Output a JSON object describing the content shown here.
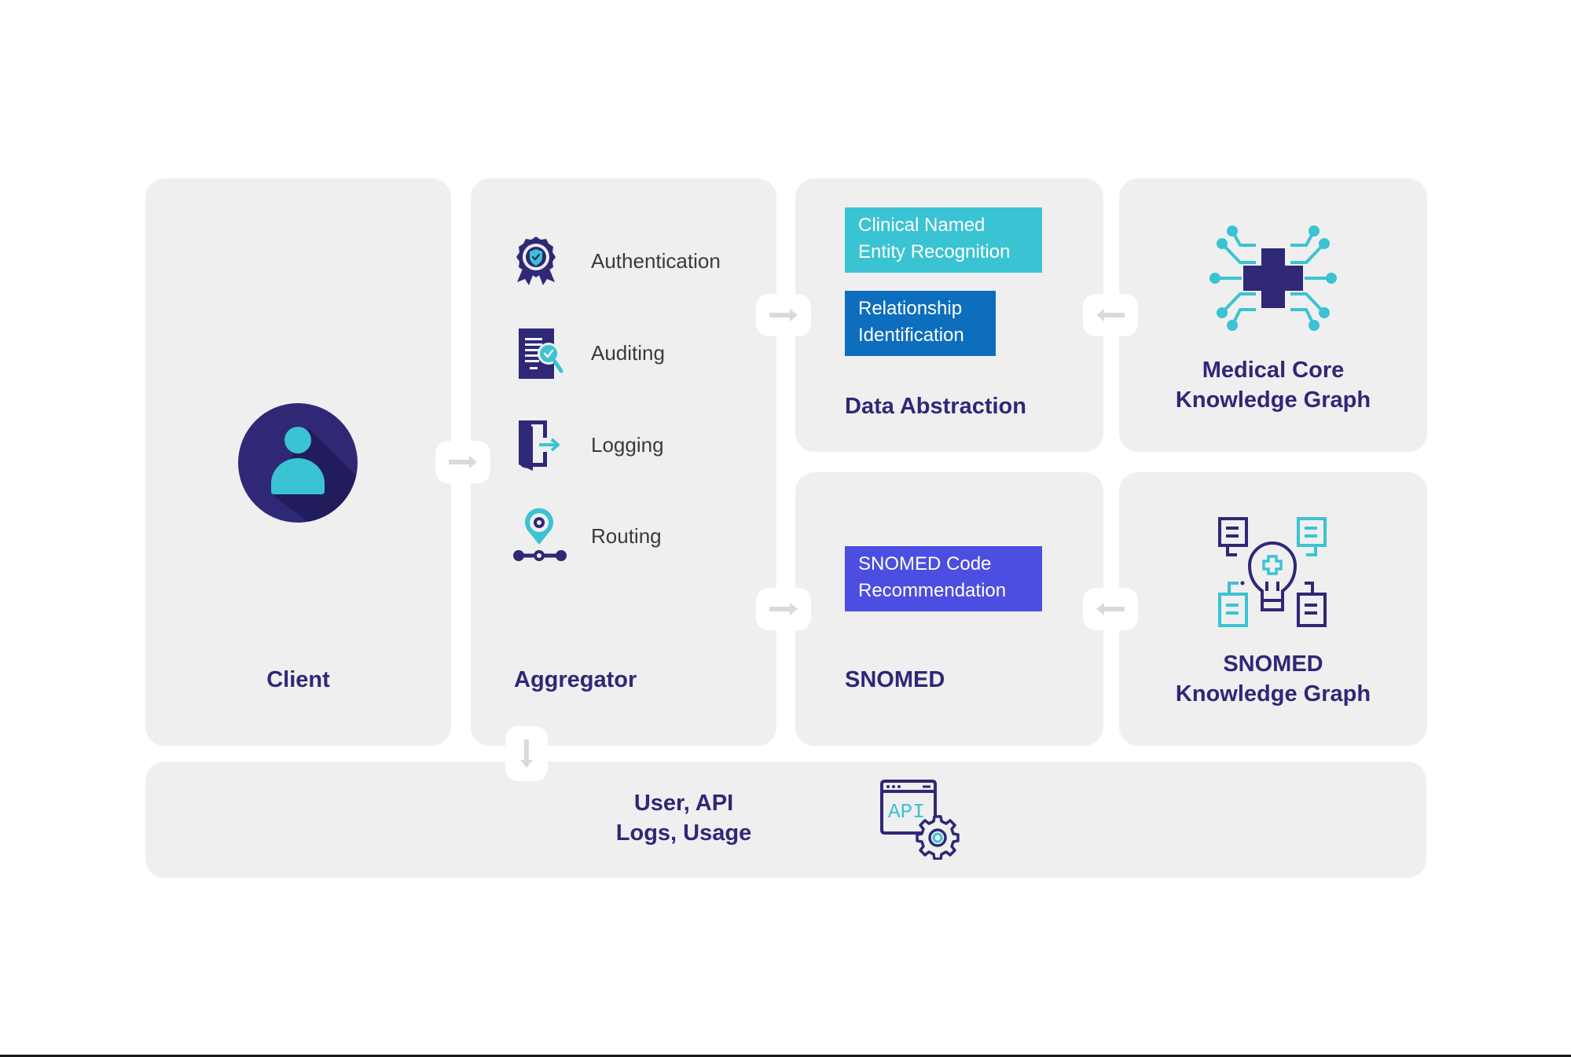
{
  "colors": {
    "navy": "#2e2877",
    "teal": "#3ac3d3",
    "blue": "#0d6ebd",
    "indigo": "#4b4ee0",
    "card": "#efeff0",
    "arrow": "#d9dadd"
  },
  "client": {
    "title": "Client",
    "icon": "user-avatar-icon"
  },
  "aggregator": {
    "title": "Aggregator",
    "items": [
      {
        "label": "Authentication",
        "icon": "badge-shield-icon"
      },
      {
        "label": "Auditing",
        "icon": "document-search-icon"
      },
      {
        "label": "Logging",
        "icon": "door-exit-icon"
      },
      {
        "label": "Routing",
        "icon": "location-route-icon"
      }
    ]
  },
  "data_abstraction": {
    "title": "Data Abstraction",
    "tags": [
      {
        "line1": "Clinical Named",
        "line2": "Entity Recognition"
      },
      {
        "line1": "Relationship",
        "line2": "Identification"
      }
    ]
  },
  "medical_core": {
    "line1": "Medical Core",
    "line2": "Knowledge Graph",
    "icon": "medical-cross-network-icon"
  },
  "snomed": {
    "title": "SNOMED",
    "tag": {
      "line1": "SNOMED Code",
      "line2": "Recommendation"
    }
  },
  "snomed_kg": {
    "line1": "SNOMED",
    "line2": "Knowledge Graph",
    "icon": "lightbulb-documents-icon"
  },
  "storage": {
    "line1": "User, API",
    "line2": "Logs, Usage",
    "icon": "api-settings-icon",
    "icon_text": "API"
  },
  "connectors": [
    {
      "from": "Client",
      "to": "Aggregator",
      "direction": "right"
    },
    {
      "from": "Aggregator",
      "to": "Data Abstraction",
      "direction": "right"
    },
    {
      "from": "Medical Core Knowledge Graph",
      "to": "Data Abstraction",
      "direction": "left"
    },
    {
      "from": "Aggregator",
      "to": "SNOMED",
      "direction": "right"
    },
    {
      "from": "SNOMED Knowledge Graph",
      "to": "SNOMED",
      "direction": "left"
    },
    {
      "from": "Aggregator",
      "to": "User, API Logs, Usage",
      "direction": "down"
    }
  ]
}
